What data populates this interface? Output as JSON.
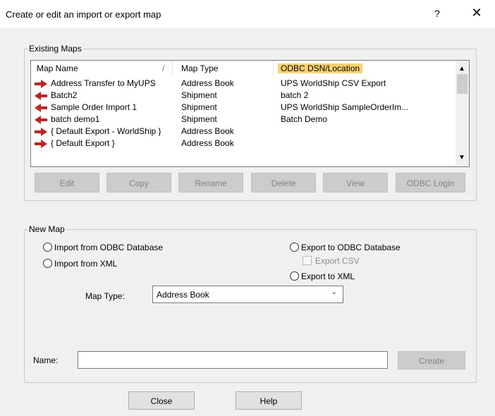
{
  "window": {
    "title": "Create or edit an import or export map",
    "help_glyph": "?",
    "close_glyph": "✕"
  },
  "existing_maps": {
    "legend": "Existing Maps",
    "columns": {
      "name": "Map Name",
      "sort_glyph": "/",
      "type": "Map Type",
      "dsn": "ODBC DSN/Location"
    },
    "rows": [
      {
        "name": "Address Transfer to MyUPS",
        "type": "Address Book",
        "dsn": "UPS WorldShip CSV Export",
        "icon": "export-arrow-icon"
      },
      {
        "name": "Batch2",
        "type": "Shipment",
        "dsn": "batch 2",
        "icon": "import-arrow-icon"
      },
      {
        "name": "Sample Order Import 1",
        "type": "Shipment",
        "dsn": "UPS WorldShip SampleOrderIm...",
        "icon": "import-arrow-icon"
      },
      {
        "name": "batch demo1",
        "type": "Shipment",
        "dsn": "Batch Demo",
        "icon": "import-arrow-icon"
      },
      {
        "name": "{ Default Export - WorldShip }",
        "type": "Address Book",
        "dsn": "",
        "icon": "export-arrow-icon"
      },
      {
        "name": "{ Default Export }",
        "type": "Address Book",
        "dsn": "",
        "icon": "export-arrow-icon"
      }
    ],
    "scroll_up_glyph": "▲",
    "scroll_down_glyph": "▼",
    "buttons": {
      "edit": "Edit",
      "copy": "Copy",
      "rename": "Rename",
      "delete": "Delete",
      "view": "View",
      "odbc_login": "ODBC Login"
    }
  },
  "new_map": {
    "legend": "New Map",
    "import_odbc": "Import from ODBC Database",
    "import_xml": "Import from XML",
    "export_odbc": "Export to ODBC Database",
    "export_csv": "Export CSV",
    "export_xml": "Export to XML",
    "map_type_label": "Map Type:",
    "map_type_value": "Address Book",
    "map_type_arrow": "⌄"
  },
  "name_label": "Name:",
  "name_value": "",
  "create_button": "Create",
  "close_button": "Close",
  "help_button": "Help",
  "colors": {
    "export_icon": "#cc1f1f",
    "import_icon": "#cc1f1f",
    "odbc_header": "#fbd36e"
  }
}
